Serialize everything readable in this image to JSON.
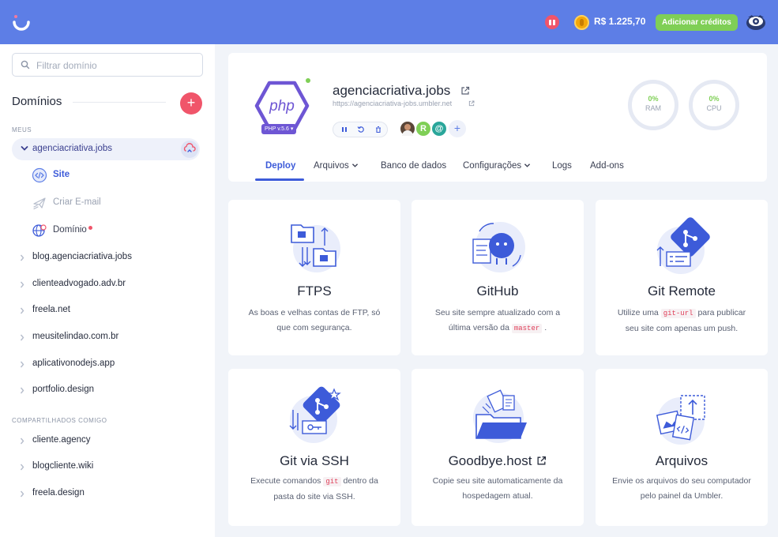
{
  "topbar": {
    "balance": "R$ 1.225,70",
    "credit_button": "Adicionar créditos",
    "icons": [
      "umbler-logo-icon",
      "gift-icon",
      "coin-icon",
      "user-avatar"
    ]
  },
  "sidebar": {
    "filter_placeholder": "Filtrar domínio",
    "title": "Domínios",
    "mine_label": "MEUS",
    "active_domain": "agenciacriativa.jobs",
    "sub_items": [
      {
        "label": "Site",
        "icon": "code-icon",
        "active": true
      },
      {
        "label": "Criar E-mail",
        "icon": "paper-plane-icon",
        "active": false
      },
      {
        "label": "Domínio",
        "icon": "globe-icon",
        "active": false
      }
    ],
    "domains": [
      "blog.agenciacriativa.jobs",
      "clienteadvogado.adv.br",
      "freela.net",
      "meusitelindao.com.br",
      "aplicativonodejs.app",
      "portfolio.design"
    ],
    "shared_label": "COMPARTILHADOS COMIGO",
    "shared_domains": [
      "cliente.agency",
      "blogcliente.wiki",
      "freela.design"
    ]
  },
  "site": {
    "name": "agenciacriativa.jobs",
    "url": "https://agenciacriativa-jobs.umbler.net",
    "php_label": "php",
    "php_version": "PHP v.5.6",
    "team": [
      "R",
      "@"
    ],
    "ram": {
      "value": "0%",
      "label": "RAM"
    },
    "cpu": {
      "value": "0%",
      "label": "CPU"
    },
    "tabs": [
      "Deploy",
      "Arquivos",
      "Banco de dados",
      "Configurações",
      "Logs",
      "Add-ons"
    ]
  },
  "cards": [
    {
      "title": "FTPS",
      "desc": "As boas e velhas contas de FTP, só que com segurança."
    },
    {
      "title": "GitHub",
      "desc_a": "Seu site sempre atualizado com a última versão da",
      "code": "master",
      "desc_b": "."
    },
    {
      "title": "Git Remote",
      "desc_a": "Utilize uma",
      "code": "git-url",
      "desc_b": "para publicar seu site com apenas um push."
    },
    {
      "title": "Git via SSH",
      "desc_a": "Execute comandos",
      "code": "git",
      "desc_b": "dentro da pasta do site via SSH."
    },
    {
      "title": "Goodbye.host",
      "desc": "Copie seu site automaticamente da hospedagem atual."
    },
    {
      "title": "Arquivos",
      "desc": "Envie os arquivos do seu computador pelo painel da Umbler."
    }
  ],
  "colors": {
    "brand": "#5d7ee6",
    "accent": "#3d5bd9",
    "danger": "#f0556a",
    "success": "#7fcf56"
  }
}
